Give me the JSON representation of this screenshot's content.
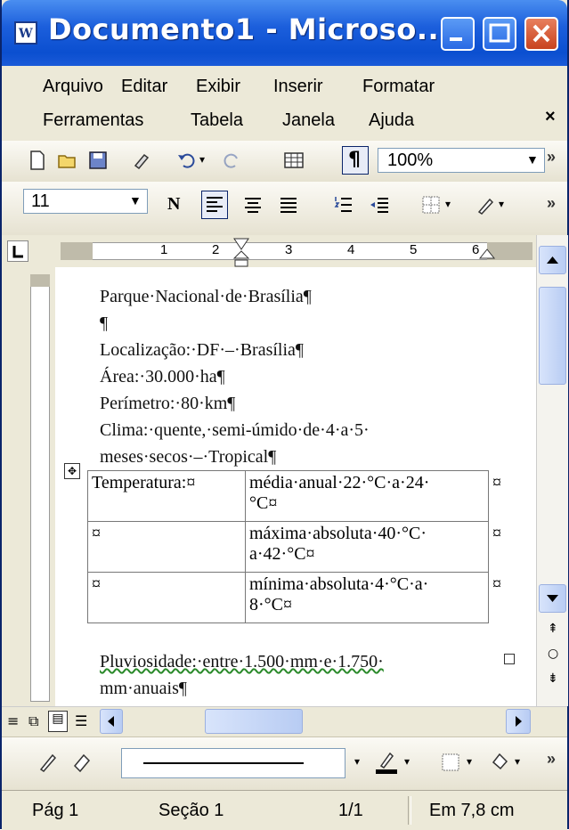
{
  "window": {
    "title": "Documento1 - Microso..."
  },
  "menu": {
    "row1": [
      "Arquivo",
      "Editar",
      "Exibir",
      "Inserir",
      "Formatar"
    ],
    "row2": [
      "Ferramentas",
      "Tabela",
      "Janela",
      "Ajuda"
    ],
    "close": "×"
  },
  "toolbar": {
    "zoom": "100%",
    "font_size": "11",
    "bold_label": "N",
    "pilcrow": "¶"
  },
  "ruler": {
    "numbers": [
      "1",
      "2",
      "3",
      "4",
      "5",
      "6"
    ]
  },
  "document": {
    "lines": [
      "Parque·Nacional·de·Brasília¶",
      "¶",
      "Localização:·DF·–·Brasília¶",
      "Área:·30.000·ha¶",
      "Perímetro:·80·km¶",
      "Clima:·quente,·semi-úmido·de·4·a·5·",
      "meses·secos·–·Tropical¶"
    ],
    "table": [
      [
        "Temperatura:¤",
        "média·anual·22·°C·a·24·",
        "°C¤"
      ],
      [
        "¤",
        "máxima·absoluta·40·°C·",
        "a·42·°C¤"
      ],
      [
        "¤",
        "mínima·absoluta·4·°C·a·",
        "8·°C¤"
      ]
    ],
    "row_end": "¤",
    "after": [
      "Pluviosidade:·entre·1.500·mm·e·1.750·",
      "mm·anuais¶"
    ]
  },
  "status": {
    "page": "Pág 1",
    "section": "Seção 1",
    "pages": "1/1",
    "position": "Em 7,8 cm"
  },
  "colors": {
    "titlebar": "#0b4fd0",
    "chrome": "#ece9d8"
  }
}
